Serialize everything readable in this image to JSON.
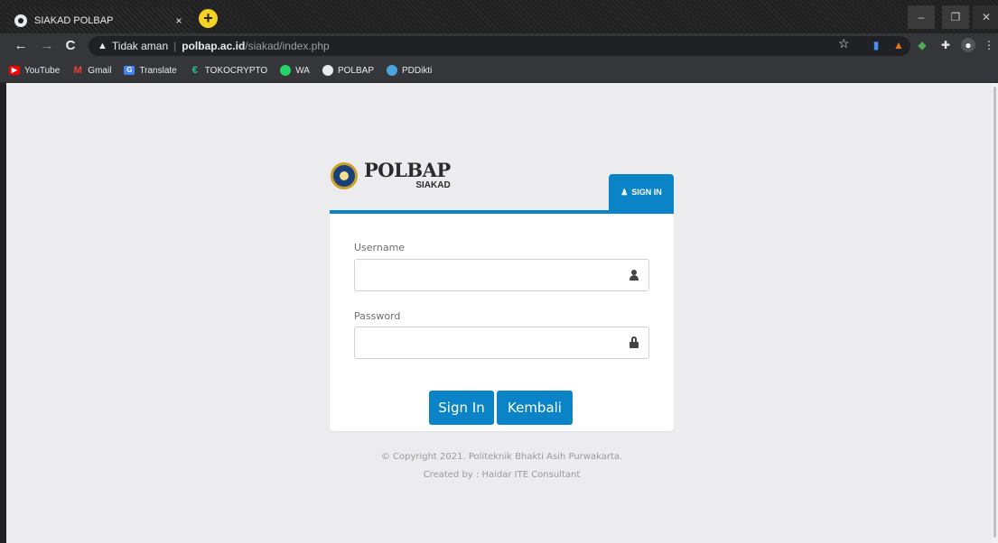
{
  "browser": {
    "tab_title": "SIAKAD POLBAP",
    "tab_close": "×",
    "new_tab": "+",
    "security_label": "Tidak aman",
    "url_host": "polbap.ac.id",
    "url_path": "/siakad/index.php",
    "window_controls": {
      "minimize": "–",
      "maximize": "❐",
      "close": "✕"
    }
  },
  "bookmarks": [
    {
      "label": "YouTube",
      "icon": "youtube-icon",
      "color": "#ff0000"
    },
    {
      "label": "Gmail",
      "icon": "gmail-icon",
      "color": "#ea4335"
    },
    {
      "label": "Translate",
      "icon": "translate-icon",
      "color": "#4285f4"
    },
    {
      "label": "TOKOCRYPTO",
      "icon": "tokocrypto-icon",
      "color": "#1ec98b"
    },
    {
      "label": "WA",
      "icon": "whatsapp-icon",
      "color": "#25d366"
    },
    {
      "label": "POLBAP",
      "icon": "globe-icon",
      "color": "#e8eaed"
    },
    {
      "label": "PDDikti",
      "icon": "pddikti-icon",
      "color": "#4aa3df"
    }
  ],
  "brand": {
    "name": "POLBAP",
    "subtitle": "SIAKAD"
  },
  "signin_tab": {
    "label": "SIGN IN"
  },
  "form": {
    "username_label": "Username",
    "username_value": "",
    "password_label": "Password",
    "password_value": "",
    "signin_button": "Sign In",
    "back_button": "Kembali"
  },
  "footer": {
    "copyright": "© Copyright 2021. Politeknik Bhakti Asih Purwakarta.",
    "credit": "Created by : Haidar ITE Consultant"
  },
  "colors": {
    "accent": "#0a84c6",
    "page_bg": "#ececef"
  }
}
